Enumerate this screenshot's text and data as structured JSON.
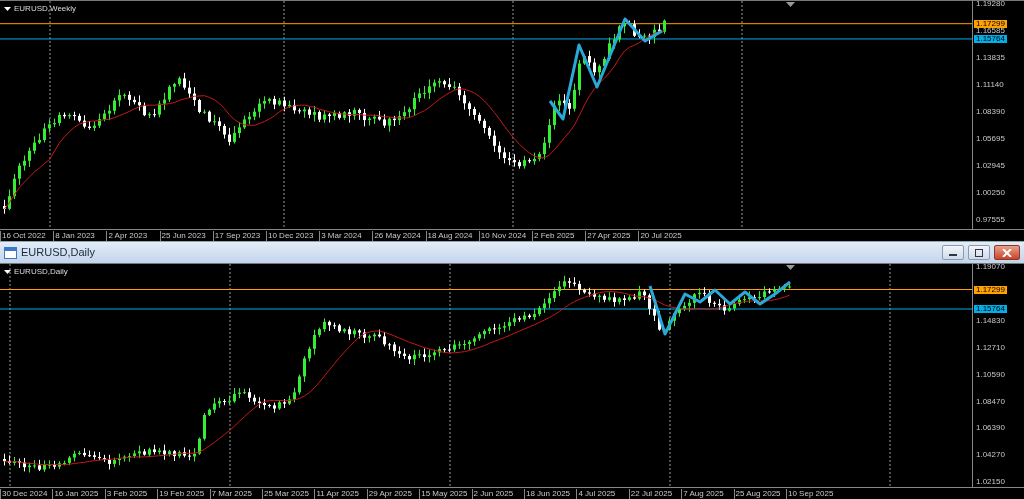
{
  "top_chart": {
    "title": "EURUSD,Weekly",
    "price_labels": [
      "1.19280",
      "1.16585",
      "1.13835",
      "1.11140",
      "1.08390",
      "1.05695",
      "1.02945",
      "1.00250",
      "0.97555"
    ],
    "levels": [
      {
        "label": "1.17299",
        "color": "#ffa200"
      },
      {
        "label": "1.15764",
        "color": "#00aee8"
      }
    ],
    "time_labels": [
      "16 Oct 2022",
      "8 Jan 2023",
      "2 Apr 2023",
      "25 Jun 2023",
      "17 Sep 2023",
      "10 Dec 2023",
      "3 Mar 2024",
      "26 May 2024",
      "18 Aug 2024",
      "10 Nov 2024",
      "2 Feb 2025",
      "27 Apr 2025",
      "20 Jul 2025"
    ]
  },
  "window": {
    "title": "EURUSD,Daily"
  },
  "bottom_chart": {
    "title": "EURUSD,Daily",
    "price_labels": [
      "1.19070",
      "1.14830",
      "1.12710",
      "1.10590",
      "1.08470",
      "1.06390",
      "1.04270",
      "1.02150"
    ],
    "levels": [
      {
        "label": "1.17299",
        "color": "#ffa200"
      },
      {
        "label": "1.15764",
        "color": "#00aee8"
      }
    ],
    "time_labels": [
      "30 Dec 2024",
      "16 Jan 2025",
      "3 Feb 2025",
      "19 Feb 2025",
      "7 Mar 2025",
      "25 Mar 2025",
      "11 Apr 2025",
      "29 Apr 2025",
      "15 May 2025",
      "2 Jun 2025",
      "18 Jun 2025",
      "4 Jul 2025",
      "22 Jul 2025",
      "7 Aug 2025",
      "25 Aug 2025",
      "10 Sep 2025"
    ]
  }
}
